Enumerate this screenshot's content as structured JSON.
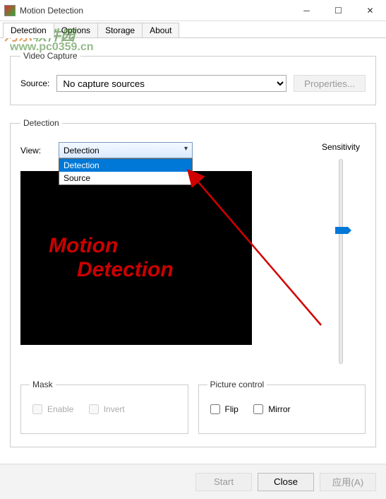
{
  "window": {
    "title": "Motion Detection"
  },
  "tabs": {
    "detection": "Detection",
    "options": "Options",
    "storage": "Storage",
    "about": "About"
  },
  "videoCapture": {
    "legend": "Video Capture",
    "sourceLabel": "Source:",
    "sourceValue": "No capture sources",
    "propertiesBtn": "Properties..."
  },
  "detection": {
    "legend": "Detection",
    "viewLabel": "View:",
    "selected": "Detection",
    "options": {
      "detection": "Detection",
      "source": "Source"
    },
    "sensitivityLabel": "Sensitivity",
    "preview": {
      "line1": "Motion",
      "line2": "Detection"
    },
    "mask": {
      "legend": "Mask",
      "enable": "Enable",
      "invert": "Invert"
    },
    "picture": {
      "legend": "Picture control",
      "flip": "Flip",
      "mirror": "Mirror"
    }
  },
  "footer": {
    "start": "Start",
    "close": "Close",
    "apply": "应用(A)"
  },
  "watermark": {
    "site1a": "河东",
    "site1b": "软件园",
    "site2": "www.pc0359.cn"
  }
}
